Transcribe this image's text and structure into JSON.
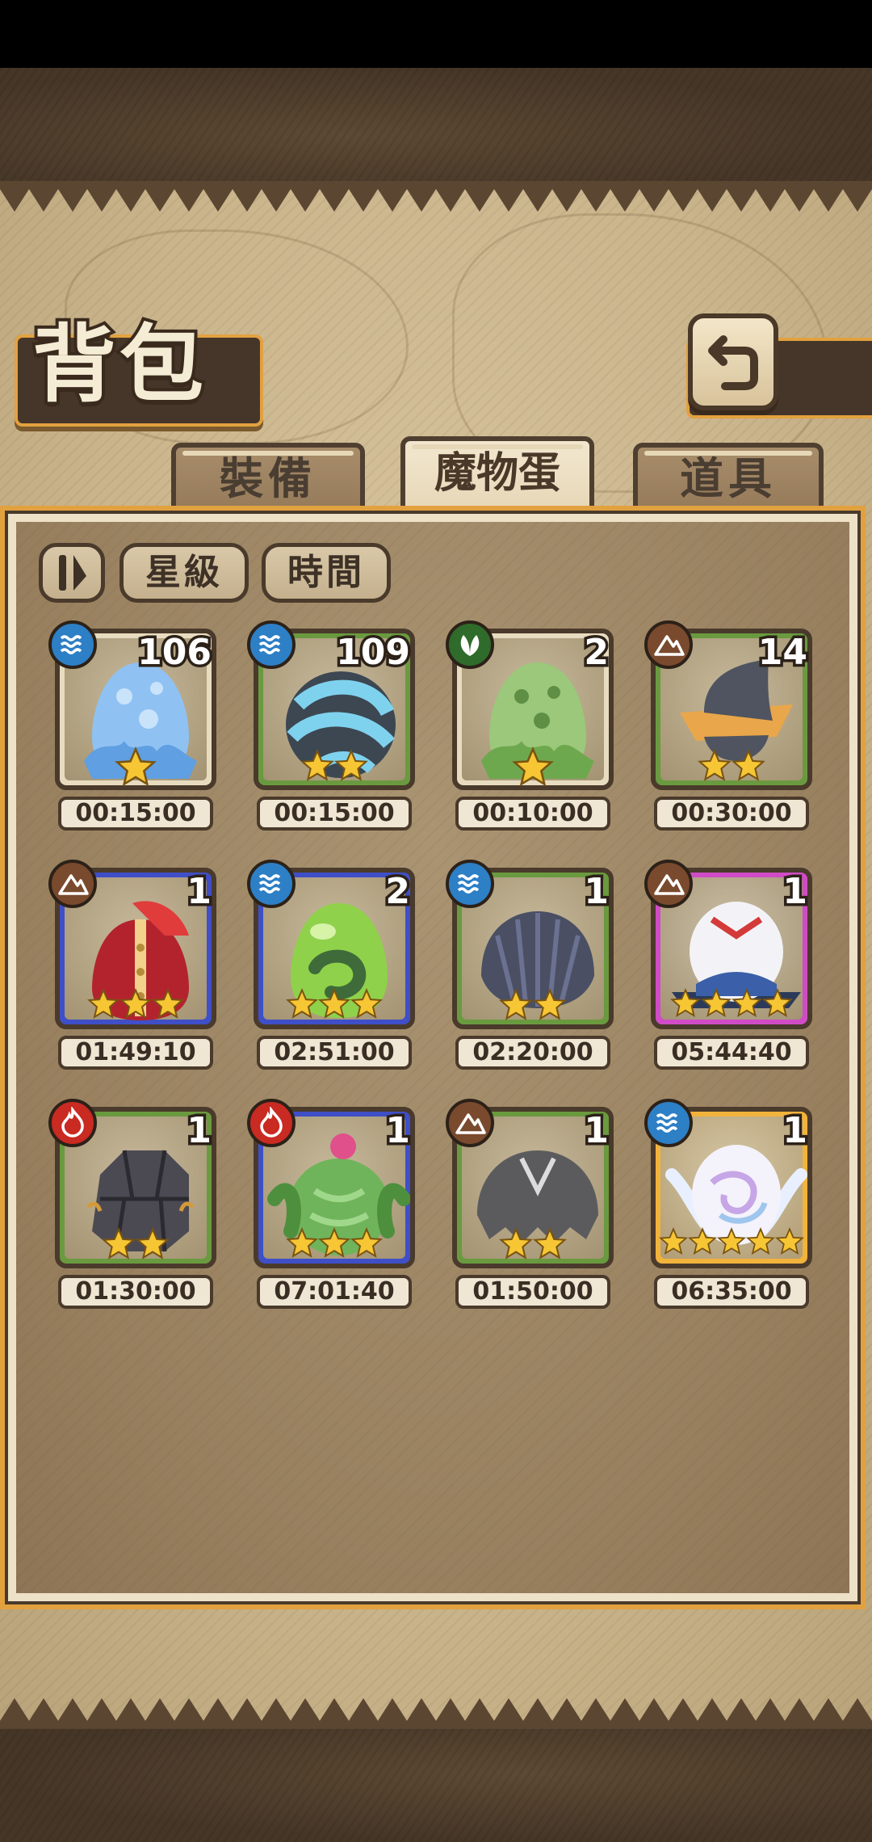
{
  "header": {
    "title": "背包",
    "back_icon": "return-arrow-icon"
  },
  "tabs": [
    {
      "label": "裝備",
      "active": false
    },
    {
      "label": "魔物蛋",
      "active": true
    },
    {
      "label": "道具",
      "active": false
    }
  ],
  "sort_bar": {
    "toggle_icon": "sort-direction-icon",
    "star_label": "星級",
    "time_label": "時間"
  },
  "eggs": [
    {
      "element": "water",
      "count": "106",
      "stars": 1,
      "time": "00:15:00",
      "frame": "cream"
    },
    {
      "element": "water",
      "count": "109",
      "stars": 2,
      "time": "00:15:00",
      "frame": "green"
    },
    {
      "element": "wood",
      "count": "2",
      "stars": 1,
      "time": "00:10:00",
      "frame": "cream"
    },
    {
      "element": "earth",
      "count": "14",
      "stars": 2,
      "time": "00:30:00",
      "frame": "green"
    },
    {
      "element": "earth",
      "count": "1",
      "stars": 3,
      "time": "01:49:10",
      "frame": "blue"
    },
    {
      "element": "water",
      "count": "2",
      "stars": 3,
      "time": "02:51:00",
      "frame": "blue"
    },
    {
      "element": "water",
      "count": "1",
      "stars": 2,
      "time": "02:20:00",
      "frame": "green"
    },
    {
      "element": "earth",
      "count": "1",
      "stars": 4,
      "time": "05:44:40",
      "frame": "pink"
    },
    {
      "element": "fire",
      "count": "1",
      "stars": 2,
      "time": "01:30:00",
      "frame": "green"
    },
    {
      "element": "fire",
      "count": "1",
      "stars": 3,
      "time": "07:01:40",
      "frame": "blue"
    },
    {
      "element": "earth",
      "count": "1",
      "stars": 2,
      "time": "01:50:00",
      "frame": "green"
    },
    {
      "element": "water",
      "count": "1",
      "stars": 5,
      "time": "06:35:00",
      "frame": "gold"
    }
  ],
  "colors": {
    "water": "#2d7fc6",
    "wood": "#2f6b2a",
    "earth": "#7a4a2e",
    "fire": "#c92a22",
    "star": "#f6c634",
    "frame_accent": "#e2a13f"
  }
}
